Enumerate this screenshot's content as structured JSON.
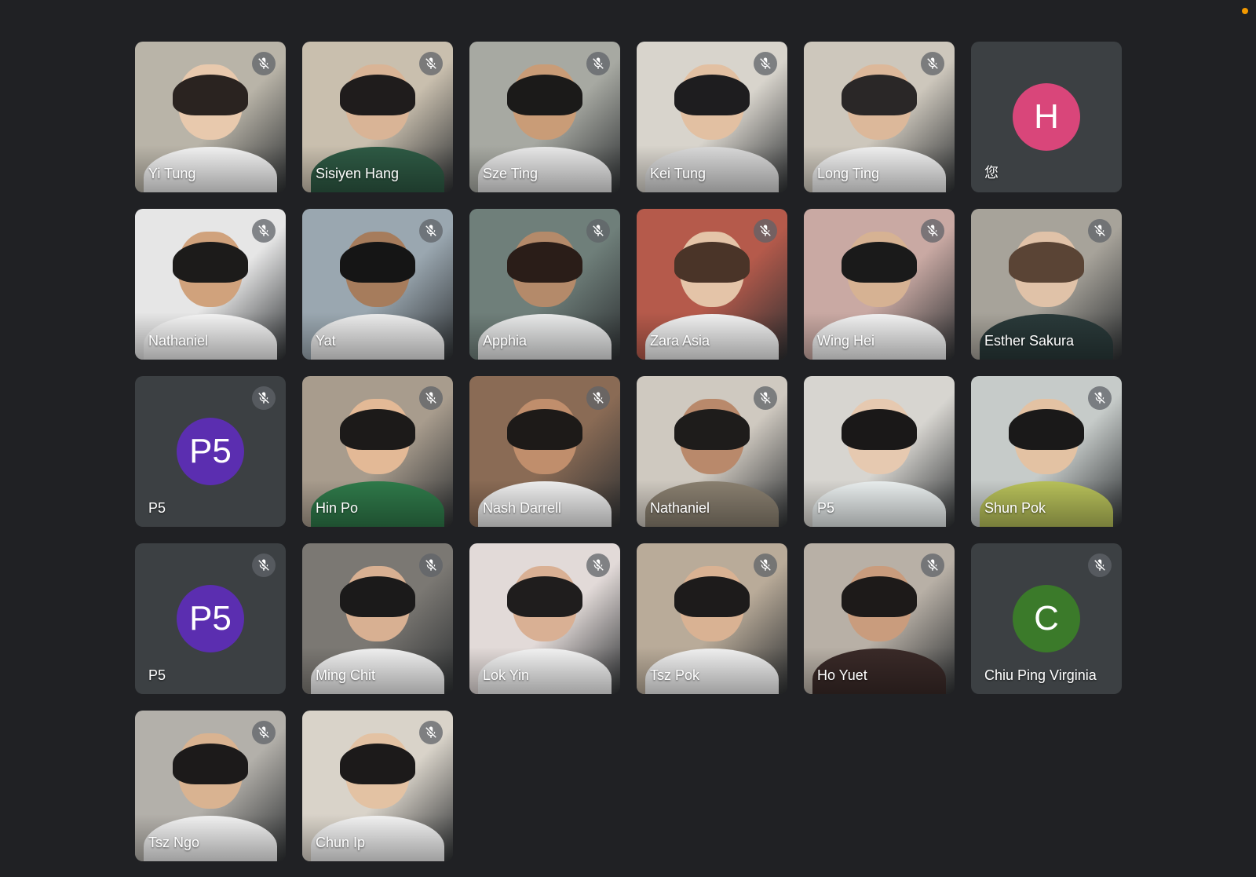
{
  "meeting": {
    "recording_indicator_color": "#f29900",
    "participants": [
      {
        "name": "Yi Tung",
        "muted": true,
        "video": true
      },
      {
        "name": "Sisiyen Hang",
        "muted": true,
        "video": true
      },
      {
        "name": "Sze Ting",
        "muted": true,
        "video": true
      },
      {
        "name": "Kei Tung",
        "muted": true,
        "video": true
      },
      {
        "name": "Long Ting",
        "muted": true,
        "video": true
      },
      {
        "name": "您",
        "muted": false,
        "video": false,
        "avatar_letter": "H",
        "avatar_color": "#d9467a"
      },
      {
        "name": "Nathaniel",
        "muted": true,
        "video": true
      },
      {
        "name": "Yat",
        "muted": true,
        "video": true
      },
      {
        "name": "Apphia",
        "muted": true,
        "video": true
      },
      {
        "name": "Zara Asia",
        "muted": true,
        "video": true
      },
      {
        "name": "Wing Hei",
        "muted": true,
        "video": true
      },
      {
        "name": "Esther Sakura",
        "muted": true,
        "video": true
      },
      {
        "name": "P5",
        "muted": true,
        "video": false,
        "avatar_letter": "P5",
        "avatar_color": "#5b2eb0"
      },
      {
        "name": "Hin Po",
        "muted": true,
        "video": true
      },
      {
        "name": "Nash Darrell",
        "muted": true,
        "video": true
      },
      {
        "name": "Nathaniel",
        "muted": true,
        "video": true
      },
      {
        "name": "P5",
        "muted": false,
        "video": true
      },
      {
        "name": "Shun Pok",
        "muted": true,
        "video": true
      },
      {
        "name": "P5",
        "muted": true,
        "video": false,
        "avatar_letter": "P5",
        "avatar_color": "#5b2eb0"
      },
      {
        "name": "Ming Chit",
        "muted": true,
        "video": true
      },
      {
        "name": "Lok Yin",
        "muted": true,
        "video": true
      },
      {
        "name": "Tsz Pok",
        "muted": true,
        "video": true
      },
      {
        "name": "Ho Yuet",
        "muted": true,
        "video": true
      },
      {
        "name": "Chiu Ping Virginia",
        "muted": true,
        "video": false,
        "avatar_letter": "C",
        "avatar_color": "#3b7a2a"
      },
      {
        "name": "Tsz Ngo",
        "muted": true,
        "video": true
      },
      {
        "name": "Chun Ip",
        "muted": true,
        "video": true
      }
    ]
  }
}
